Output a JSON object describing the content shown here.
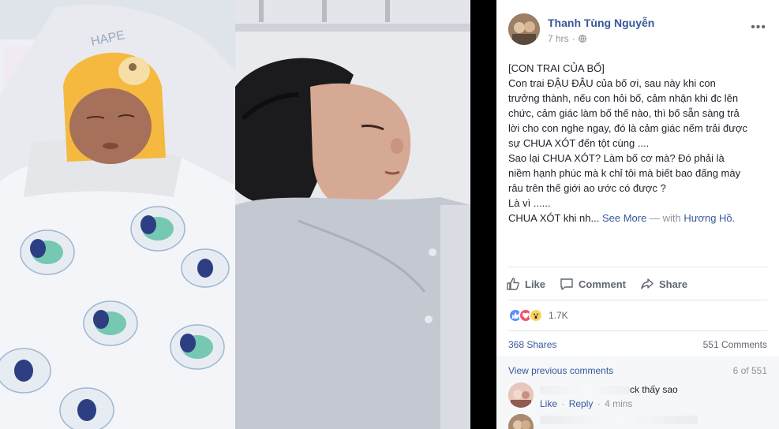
{
  "post": {
    "author": "Thanh Tùng Nguyễn",
    "time": "7 hrs",
    "more_label": "•••",
    "text_lines": [
      "[CON TRAI CỦA BỐ]",
      "Con trai ĐẬU ĐẬU của bố ơi, sau này khi con",
      "trưởng thành, nếu con hỏi bố, cảm nhận khi đc lên",
      "chức, cảm giác làm bố thế nào, thì bố sẵn sàng trả",
      "lời cho con nghe ngay, đó là cảm giác nếm trải được",
      "sự CHUA XÓT đến tột cùng ....",
      "Sao lại CHUA XÓT? Làm bố cơ mà? Đó phải là",
      "niềm hạnh phúc mà k chỉ tôi mà biết bao đấng mày",
      "râu trên thế giới ao ước có được ?",
      "Là vì ......"
    ],
    "last_line_start": "CHUA XÓT khi nh...",
    "see_more": "See More",
    "with_text": "— with",
    "tagged": "Hương Hồ."
  },
  "actions": {
    "like": "Like",
    "comment": "Comment",
    "share": "Share"
  },
  "reactions": {
    "count": "1.7K"
  },
  "stats": {
    "shares": "368 Shares",
    "comments": "551 Comments"
  },
  "comments": {
    "view_previous": "View previous comments",
    "count_of": "6 of 551",
    "first": {
      "text_visible": "ck thấy sao",
      "like": "Like",
      "reply": "Reply",
      "time": "4 mins"
    }
  },
  "colors": {
    "link": "#365899",
    "muted": "#90949c",
    "text": "#1d2129"
  }
}
